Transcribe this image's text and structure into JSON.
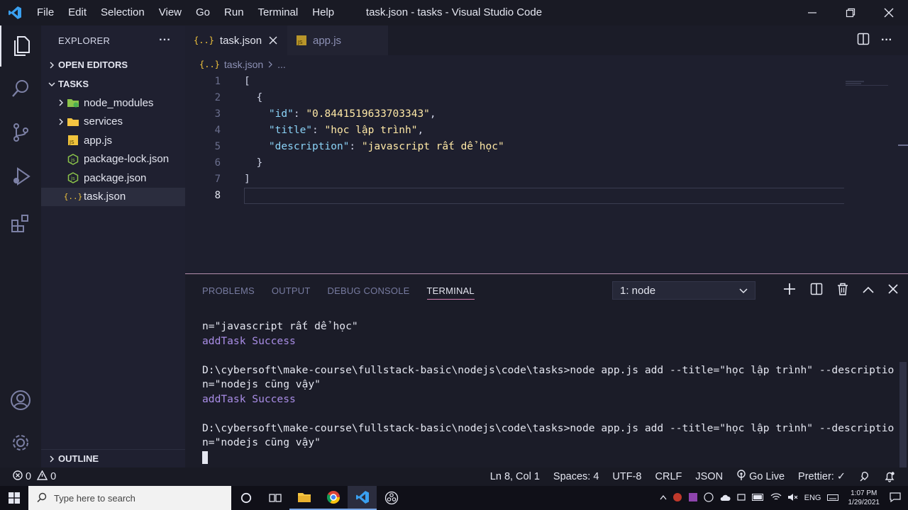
{
  "titlebar": {
    "menu": [
      "File",
      "Edit",
      "Selection",
      "View",
      "Go",
      "Run",
      "Terminal",
      "Help"
    ],
    "window_title": "task.json - tasks - Visual Studio Code"
  },
  "activity": [
    "files-icon",
    "search-icon",
    "source-control-icon",
    "run-debug-icon",
    "extensions-icon",
    "account-icon",
    "settings-gear-icon"
  ],
  "sidebar": {
    "title": "EXPLORER",
    "more": "···",
    "open_editors": "OPEN EDITORS",
    "folder": "TASKS",
    "items": [
      {
        "label": "node_modules",
        "type": "folder",
        "icon": "node-folder-icon"
      },
      {
        "label": "services",
        "type": "folder",
        "icon": "folder-icon"
      },
      {
        "label": "app.js",
        "type": "file",
        "icon": "js-file-icon"
      },
      {
        "label": "package-lock.json",
        "type": "file",
        "icon": "npm-file-icon"
      },
      {
        "label": "package.json",
        "type": "file",
        "icon": "npm-file-icon"
      },
      {
        "label": "task.json",
        "type": "file",
        "icon": "json-file-icon"
      }
    ],
    "outline": "OUTLINE"
  },
  "tabs": [
    {
      "label": "task.json",
      "icon": "json-file-icon",
      "active": true
    },
    {
      "label": "app.js",
      "icon": "js-file-icon",
      "active": false
    }
  ],
  "breadcrumb": {
    "file": "task.json",
    "more": "..."
  },
  "editor": {
    "line_numbers": [
      "1",
      "2",
      "3",
      "4",
      "5",
      "6",
      "7",
      "8"
    ],
    "current_line": 8,
    "code": {
      "l1": "[",
      "l2": "  {",
      "id_key": "\"id\"",
      "id_val": "\"0.8441519633703343\"",
      "title_key": "\"title\"",
      "title_val": "\"học lập trình\"",
      "desc_key": "\"description\"",
      "desc_val": "\"javascript rất dể học\"",
      "l6": "  }",
      "l7": "]",
      "l8": ""
    }
  },
  "panel": {
    "tabs": [
      "PROBLEMS",
      "OUTPUT",
      "DEBUG CONSOLE",
      "TERMINAL"
    ],
    "active_tab": "TERMINAL",
    "terminal_select": "1: node",
    "lines": [
      {
        "text": "n=\"javascript rất dể học\"",
        "kind": "normal"
      },
      {
        "text": "addTask Success",
        "kind": "ok"
      },
      {
        "text": "",
        "kind": "normal"
      },
      {
        "text": "D:\\cybersoft\\make-course\\fullstack-basic\\nodejs\\code\\tasks>node app.js add --title=\"học lập trình\" --descriptio",
        "kind": "normal"
      },
      {
        "text": "n=\"nodejs cũng vậy\"",
        "kind": "normal"
      },
      {
        "text": "addTask Success",
        "kind": "ok"
      },
      {
        "text": "",
        "kind": "normal"
      },
      {
        "text": "D:\\cybersoft\\make-course\\fullstack-basic\\nodejs\\code\\tasks>node app.js add --title=\"học lập trình\" --descriptio",
        "kind": "normal"
      },
      {
        "text": "n=\"nodejs cũng vậy\"",
        "kind": "normal"
      }
    ]
  },
  "statusbar": {
    "errors": "0",
    "warnings": "0",
    "position": "Ln 8, Col 1",
    "spaces": "Spaces: 4",
    "encoding": "UTF-8",
    "eol": "CRLF",
    "language": "JSON",
    "golive": "Go Live",
    "prettier": "Prettier: ✓"
  },
  "taskbar": {
    "search_placeholder": "Type here to search",
    "lang": "ENG",
    "time": "1:07 PM",
    "date": "1/29/2021"
  },
  "colors": {
    "accent": "#d57fb2",
    "json_key": "#8bd3f7",
    "json_string": "#ffe9a6",
    "success": "#a98de6"
  }
}
